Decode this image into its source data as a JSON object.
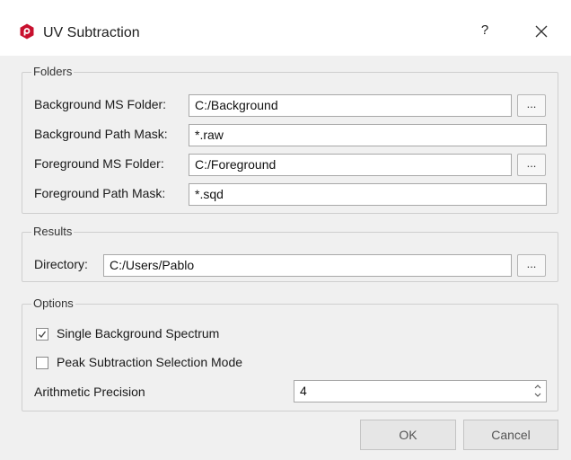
{
  "window": {
    "title": "UV Subtraction",
    "help_label": "?",
    "accent": "#c8102e"
  },
  "folders": {
    "legend": "Folders",
    "bg_ms_label": "Background MS Folder:",
    "bg_ms_value": "C:/Background",
    "bg_mask_label": "Background Path Mask:",
    "bg_mask_value": "*.raw",
    "fg_ms_label": "Foreground MS Folder:",
    "fg_ms_value": "C:/Foreground",
    "fg_mask_label": "Foreground Path Mask:",
    "fg_mask_value": "*.sqd",
    "browse_label": "..."
  },
  "results": {
    "legend": "Results",
    "dir_label": "Directory:",
    "dir_value": "C:/Users/Pablo",
    "browse_label": "..."
  },
  "options": {
    "legend": "Options",
    "single_bg_label": "Single Background Spectrum",
    "single_bg_checked": true,
    "peak_sel_label": "Peak Subtraction Selection Mode",
    "peak_sel_checked": false,
    "precision_label": "Arithmetic Precision",
    "precision_value": "4"
  },
  "buttons": {
    "ok": "OK",
    "cancel": "Cancel"
  }
}
